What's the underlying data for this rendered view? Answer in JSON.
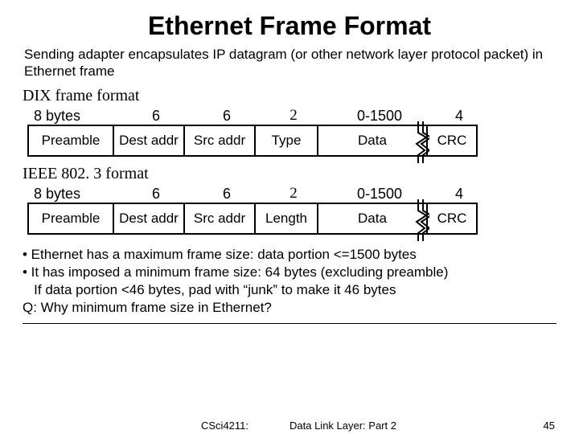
{
  "title": "Ethernet Frame Format",
  "intro": "Sending adapter encapsulates IP datagram (or other network layer protocol packet) in Ethernet frame",
  "dix": {
    "label": "DIX frame format",
    "sizes": [
      "8 bytes",
      "6",
      "6",
      "2",
      "0-1500",
      "4"
    ],
    "fields": [
      "Preamble",
      "Dest addr",
      "Src addr",
      "Type",
      "Data",
      "CRC"
    ]
  },
  "ieee": {
    "label": "IEEE 802. 3 format",
    "sizes": [
      "8 bytes",
      "6",
      "6",
      "2",
      "0-1500",
      "4"
    ],
    "fields": [
      "Preamble",
      "Dest addr",
      "Src addr",
      "Length",
      "Data",
      "CRC"
    ]
  },
  "notes": {
    "b1": "• Ethernet has a maximum frame size: data portion <=1500 bytes",
    "b2": "• It has imposed a minimum frame size: 64 bytes (excluding preamble)",
    "b3": "   If data portion <46 bytes, pad with “junk” to make it 46 bytes",
    "q": "Q: Why minimum frame size in Ethernet?"
  },
  "footer": {
    "course": "CSci4211:",
    "topic": "Data Link Layer: Part 2",
    "page": "45"
  }
}
